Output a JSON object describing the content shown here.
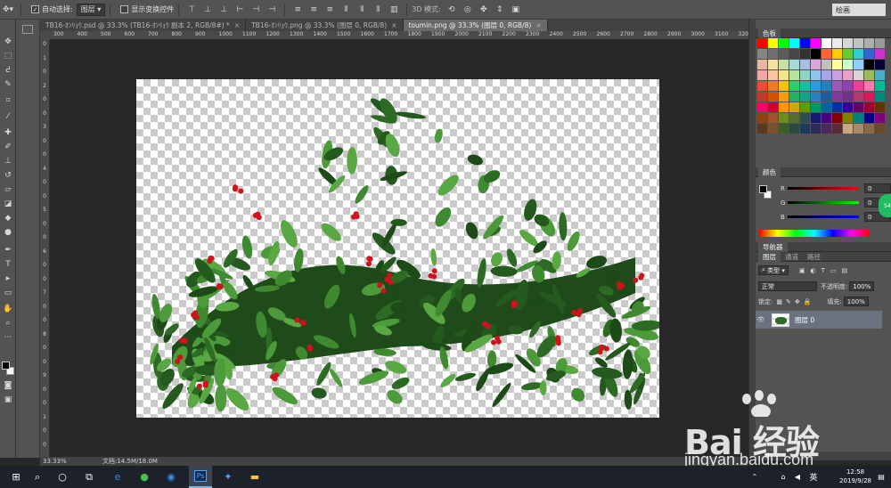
{
  "options_bar": {
    "auto_select_label": "自动选择:",
    "auto_select_value": "图层",
    "show_transform_label": "显示变换控件",
    "mode_3d_label": "3D 模式:",
    "workspace": "绘画"
  },
  "tabs": [
    {
      "label": "TB16-ｵﾝﾘｮｳ.psd @ 33.3% (TB16-ｵﾝﾘｮｳ 副本 2, RGB/8#) *",
      "active": false
    },
    {
      "label": "TB16-ｵﾝﾘｮｳ.png @ 33.3% (图层 0, RGB/8)",
      "active": false
    },
    {
      "label": "toumin.png @ 33.3% (图层 0, RGB/8)",
      "active": true
    }
  ],
  "ruler": {
    "h_ticks": [
      "300",
      "400",
      "500",
      "600",
      "700",
      "800",
      "900",
      "1000",
      "1100",
      "1200",
      "1300",
      "1400",
      "1500",
      "1600",
      "1700",
      "1800",
      "1900",
      "2000",
      "2100",
      "2200",
      "2300",
      "2400",
      "2500",
      "2600",
      "2700",
      "2800",
      "2900",
      "3000",
      "3100",
      "3200"
    ],
    "v_ticks": [
      "0",
      "1",
      "0",
      "2",
      "0",
      "0",
      "3",
      "0",
      "0",
      "4",
      "0",
      "0",
      "5",
      "0",
      "0",
      "6",
      "0",
      "0",
      "7",
      "0",
      "0",
      "8",
      "0",
      "0",
      "9",
      "0",
      "0",
      "1",
      "0",
      "0"
    ]
  },
  "tools": [
    "move-tool",
    "marquee-tool",
    "lasso-tool",
    "quick-select-tool",
    "crop-tool",
    "eyedropper-tool",
    "healing-brush-tool",
    "brush-tool",
    "clone-stamp-tool",
    "history-brush-tool",
    "eraser-tool",
    "paint-bucket-tool",
    "blur-tool",
    "dodge-tool",
    "pen-tool",
    "type-tool",
    "path-select-tool",
    "shape-tool",
    "hand-tool",
    "zoom-tool"
  ],
  "status": {
    "zoom": "33.33%",
    "doc_size": "文档:14.5M/18.0M"
  },
  "panels": {
    "swatches_title": "色板",
    "color_title": "颜色",
    "navigator_title": "导航器",
    "layers_tabs": [
      "图层",
      "通道",
      "路径"
    ],
    "color": {
      "r": "0",
      "g": "0",
      "b": "0"
    },
    "filter_kind": "类型",
    "blend_mode": "正常",
    "opacity_label": "不透明度:",
    "opacity_value": "100%",
    "lock_label": "锁定:",
    "fill_label": "填充:",
    "fill_value": "100%",
    "layer_name": "图层 0"
  },
  "swatch_colors": [
    "#ff0000",
    "#ffff00",
    "#00ff00",
    "#00ffff",
    "#0000ff",
    "#ff00ff",
    "#ffffff",
    "#ebebeb",
    "#d6d6d6",
    "#c2c2c2",
    "#adadad",
    "#999999",
    "#858585",
    "#707070",
    "#5c5c5c",
    "#474747",
    "#333333",
    "#000000",
    "#ff6633",
    "#ffcc00",
    "#66cc33",
    "#33cccc",
    "#3366cc",
    "#cc33cc",
    "#e6b8a2",
    "#f5e0a3",
    "#c6dfa5",
    "#a8d8d8",
    "#a6bde6",
    "#d7a8d7",
    "#c0c0c0",
    "#ffff99",
    "#ccffcc",
    "#99ccff",
    "#000000",
    "#000033",
    "#f4a6a6",
    "#f7c8a0",
    "#f2e48c",
    "#b7e39b",
    "#8fd6c2",
    "#8fc5e8",
    "#a6a6e8",
    "#c9a0e0",
    "#e8a0c8",
    "#d6d6d6",
    "#9bbb59",
    "#4bacc6",
    "#e74c3c",
    "#e67e22",
    "#f1c40f",
    "#2ecc71",
    "#1abc9c",
    "#3498db",
    "#2980b9",
    "#9b59b6",
    "#8e44ad",
    "#e84393",
    "#fd79a8",
    "#00b894",
    "#c0392b",
    "#d35400",
    "#f39c12",
    "#27ae60",
    "#16a085",
    "#2c81ba",
    "#1f5f99",
    "#7d3c98",
    "#6c3483",
    "#b03a70",
    "#d81b60",
    "#00897b",
    "#ff0066",
    "#cc0033",
    "#ff9900",
    "#ccaa00",
    "#669900",
    "#009966",
    "#006699",
    "#003399",
    "#330099",
    "#660066",
    "#990033",
    "#663300",
    "#8b4513",
    "#a0522d",
    "#6b8e23",
    "#556b2f",
    "#2f4f4f",
    "#191970",
    "#4b0082",
    "#800000",
    "#808000",
    "#008080",
    "#000080",
    "#800080",
    "#5a3a1e",
    "#7a5230",
    "#3e5c2a",
    "#2a4a3e",
    "#1e3a5a",
    "#2e2a5a",
    "#4a2a5a",
    "#5a2a3a",
    "#c8a882",
    "#a88a6a",
    "#886a4a",
    "#684a2a"
  ],
  "taskbar": {
    "time": "12:58",
    "date": "2019/9/28",
    "ime": "英"
  },
  "watermark": {
    "brand": "Bai 经验",
    "url": "jingyan.baidu.com"
  }
}
